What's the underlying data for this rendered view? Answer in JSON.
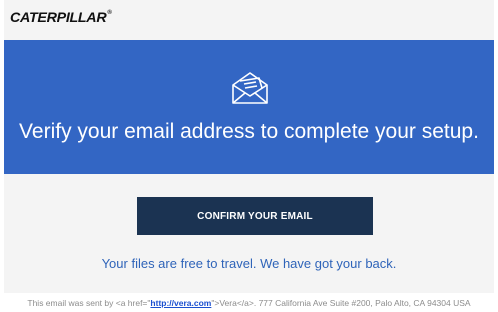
{
  "header": {
    "logo_text": "CATERPILLAR",
    "logo_mark": "®"
  },
  "banner": {
    "icon": "envelope-open-icon",
    "headline": "Verify your email address to complete your setup."
  },
  "cta": {
    "label": "CONFIRM YOUR EMAIL"
  },
  "tagline": "Your files are free to travel. We have got your back.",
  "footer": {
    "prefix": "This email was sent by <a href=\"",
    "link_text": "http://vera.com",
    "suffix": "\">Vera</a>. 777 California Ave Suite #200, Palo Alto, CA 94304 USA"
  },
  "colors": {
    "banner": "#3366c4",
    "button": "#1b3352",
    "tagline": "#2f64b9",
    "card_bg": "#f4f4f4"
  }
}
